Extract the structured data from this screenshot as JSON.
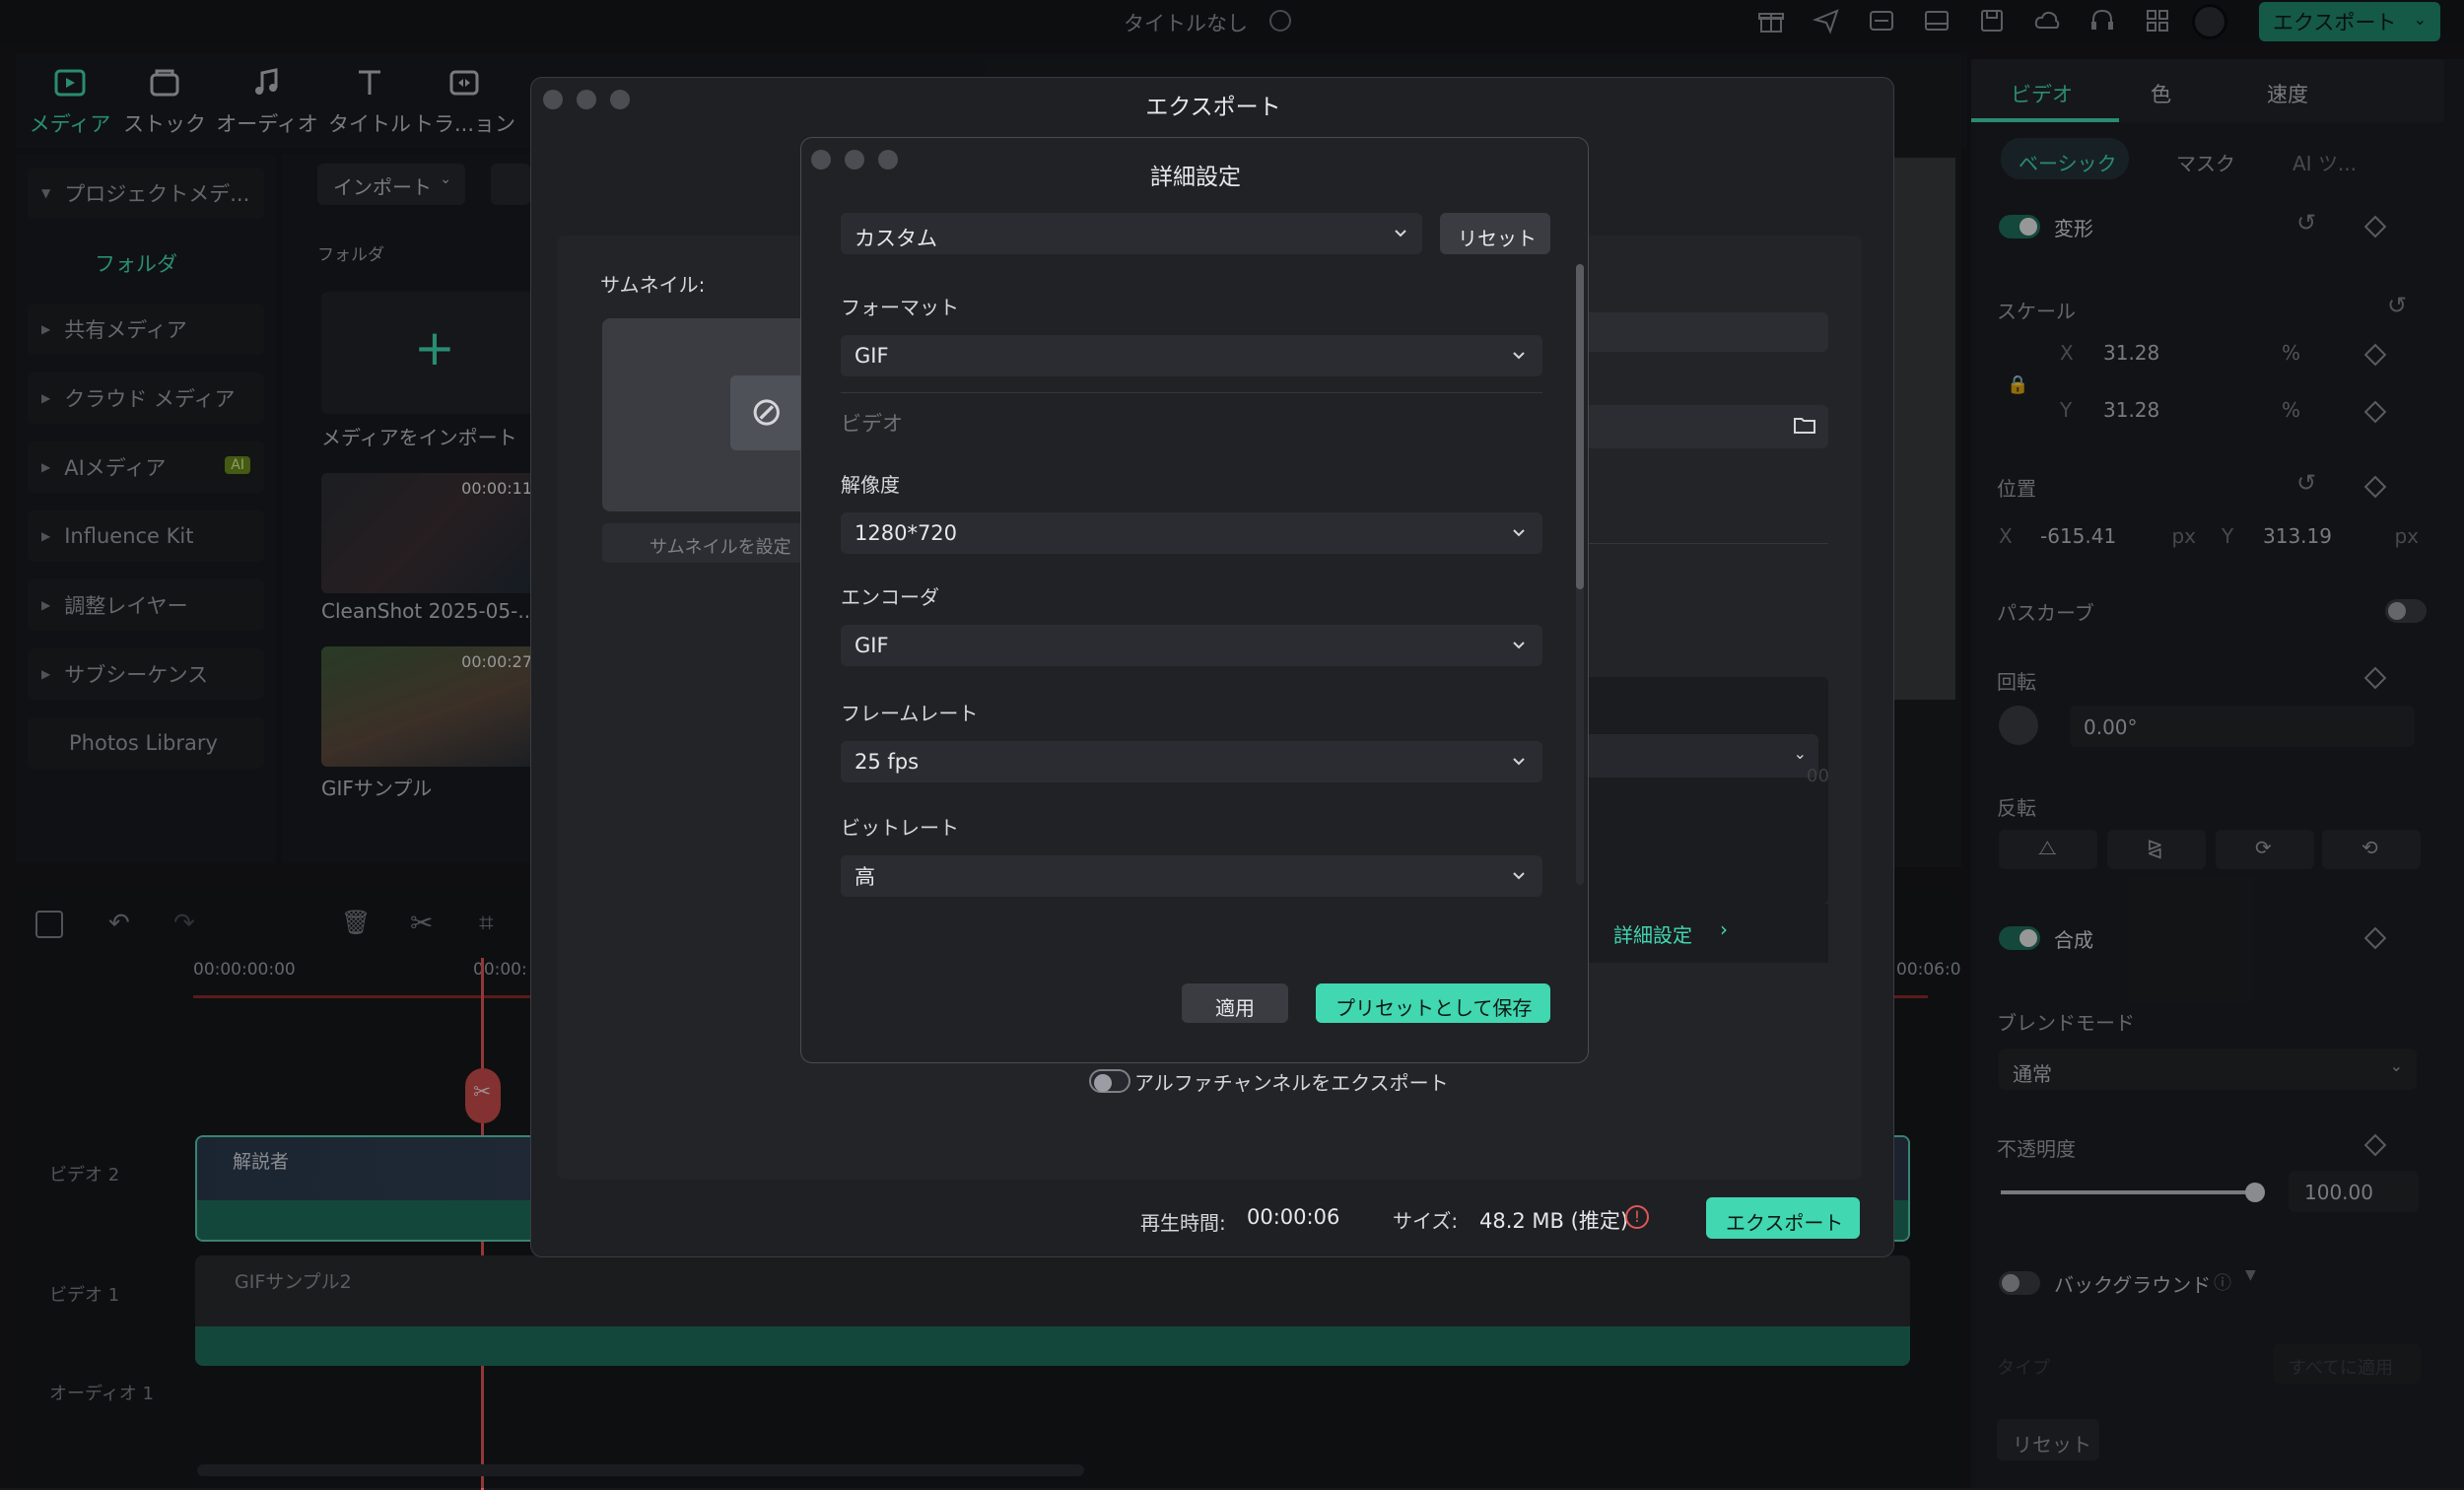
{
  "app": {
    "title": "タイトルなし",
    "export_button": "エクスポート",
    "accent": "#41d7b0"
  },
  "toolbar": {
    "items": [
      {
        "label": "メディア",
        "icon": "media-icon",
        "active": true
      },
      {
        "label": "ストック",
        "icon": "stock-icon"
      },
      {
        "label": "オーディオ",
        "icon": "audio-icon"
      },
      {
        "label": "タイトル",
        "icon": "title-icon"
      },
      {
        "label": "トラ...ョン",
        "icon": "transition-icon"
      }
    ]
  },
  "sidebar": {
    "items": [
      {
        "label": "プロジェクトメデ..."
      },
      {
        "label": "フォルダ"
      },
      {
        "label": "共有メディア"
      },
      {
        "label": "クラウド メディア"
      },
      {
        "label": "AIメディア",
        "badge": "AI"
      },
      {
        "label": "Influence Kit"
      },
      {
        "label": "調整レイヤー"
      },
      {
        "label": "サブシーケンス"
      },
      {
        "label": "Photos Library"
      }
    ]
  },
  "media": {
    "import_label": "インポート",
    "folder_label": "フォルダ",
    "import_media_label": "メディアをインポート",
    "items": [
      {
        "name": "CleanShot 2025-05-...",
        "duration": "00:00:11"
      },
      {
        "name": "GIFサンプル",
        "duration": "00:00:27"
      }
    ]
  },
  "timeline": {
    "time_start": "00:00:00:00",
    "time_mid": "00:00:",
    "time_end": "00:06:0",
    "tracks": [
      {
        "label": "ビデオ 2",
        "clip": "解説者"
      },
      {
        "label": "ビデオ 1",
        "clip": "GIFサンプル2"
      },
      {
        "label": "オーディオ 1"
      }
    ]
  },
  "right_panel": {
    "tabs": [
      "ビデオ",
      "色",
      "速度"
    ],
    "subtabs": [
      "ベーシック",
      "マスク",
      "AI ツ..."
    ],
    "transform_label": "変形",
    "scale_label": "スケール",
    "scale_x_label": "X",
    "scale_x": "31.28",
    "scale_y_label": "Y",
    "scale_y": "31.28",
    "percent": "%",
    "position_label": "位置",
    "pos_x_label": "X",
    "pos_x": "-615.41",
    "pos_y_label": "Y",
    "pos_y": "313.19",
    "px": "px",
    "path_curve_label": "パスカーブ",
    "rotate_label": "回転",
    "rotate_value": "0.00°",
    "flip_label": "反転",
    "composite_label": "合成",
    "blend_label": "ブレンドモード",
    "blend_value": "通常",
    "opacity_label": "不透明度",
    "opacity_value": "100.00",
    "opacity_fraction": 1.0,
    "background_label": "バックグラウンド",
    "type_label": "タイプ",
    "apply_all_label": "すべてに適用",
    "reset_label": "リセット"
  },
  "export_dialog": {
    "title": "エクスポート",
    "thumbnail_label": "サムネイル:",
    "set_thumbnail": "サムネイルを設定",
    "advanced_link": "詳細設定",
    "alpha_label": "アルファチャンネルをエクスポート",
    "duration_label": "再生時間:",
    "duration_value": "00:00:06",
    "size_label": "サイズ:",
    "size_value": "48.2 MB (推定)",
    "export_button": "エクスポート",
    "bg_fragment": "00"
  },
  "advanced": {
    "title": "詳細設定",
    "preset": "カスタム",
    "reset_button": "リセット",
    "format_label": "フォーマット",
    "format_value": "GIF",
    "video_section": "ビデオ",
    "resolution_label": "解像度",
    "resolution_value": "1280*720",
    "encoder_label": "エンコーダ",
    "encoder_value": "GIF",
    "framerate_label": "フレームレート",
    "framerate_value": "25 fps",
    "bitrate_label": "ビットレート",
    "bitrate_value": "高",
    "apply_button": "適用",
    "save_preset_button": "プリセットとして保存"
  }
}
